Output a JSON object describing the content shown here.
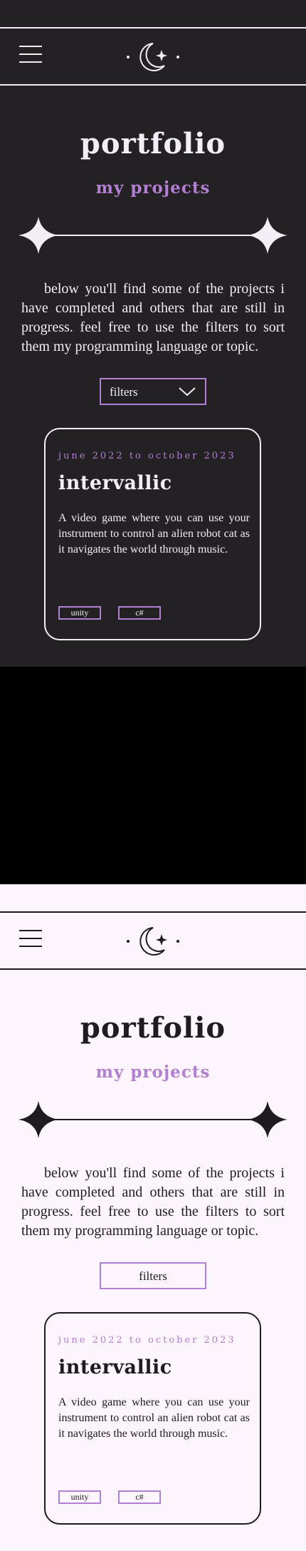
{
  "views": [
    {
      "theme": "dark",
      "title": "portfolio",
      "subtitle": "my projects",
      "intro": "below you'll find some of the projects i have completed and others that are still in progress. feel free to use the filters to sort them my programming language or topic.",
      "filters_label": "filters",
      "project": {
        "date": "june 2022 to october 2023",
        "title": "intervallic",
        "description": "A video game where you can use your instrument to control an alien robot cat as it navigates the world through music.",
        "tags": [
          "unity",
          "c#"
        ]
      }
    },
    {
      "theme": "light",
      "title": "portfolio",
      "subtitle": "my projects",
      "intro": "below you'll find some of the projects i have completed and others that are still in progress. feel free to use the filters to sort them my programming language or topic.",
      "filters_label": "filters",
      "project": {
        "date": "june 2022 to october 2023",
        "title": "intervallic",
        "description": "A video game where you can use your instrument to control an alien robot cat as it navigates the world through music.",
        "tags": [
          "unity",
          "c#"
        ]
      }
    }
  ],
  "icons": {
    "menu": "hamburger-menu-icon",
    "logo": "crescent-moon-sparkle-logo",
    "divider": "four-point-star-divider",
    "filters_dropdown": "chevron-down-icon"
  },
  "colors": {
    "dark_background": "#232123",
    "light_background": "#fdf5fd",
    "accent_purple": "#b37fd3",
    "separator_background": "#000000"
  }
}
